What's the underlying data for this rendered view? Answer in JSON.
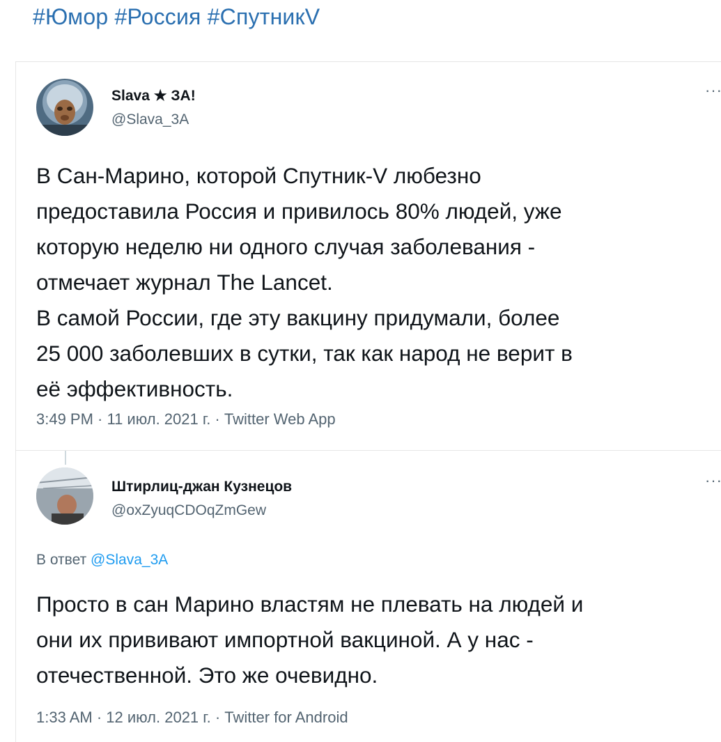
{
  "header": {
    "hashtags": "#Юмор #Россия #СпутникV"
  },
  "tweets": [
    {
      "name": "Slava ★ ЗА!",
      "handle": "@Slava_3A",
      "more": "···",
      "lines": [
        "В Сан-Марино, которой Спутник-V любезно",
        "предоставила Россия и привилось 80% людей, уже",
        "которую неделю ни одного случая заболевания -",
        "отмечает журнал The Lancet.",
        "В самой России, где эту вакцину придумали, более",
        "25 000 заболевших в сутки, так как народ не верит в",
        "её эффективность."
      ],
      "meta": "3:49 PM · 11 июл. 2021 г. · Twitter Web App"
    },
    {
      "name": "Штирлиц-джан Кузнецов",
      "handle": "@oxZyuqCDOqZmGew",
      "more": "···",
      "reply_prefix": "В ответ",
      "reply_handle": "@Slava_3A",
      "lines": [
        "Просто в сан Марино властям не плевать на людей и",
        "они их прививают импортной вакциной. А у нас -",
        "отечественной. Это же очевидно."
      ],
      "meta": "1:33 AM · 12 июл. 2021 г. · Twitter for Android"
    }
  ]
}
